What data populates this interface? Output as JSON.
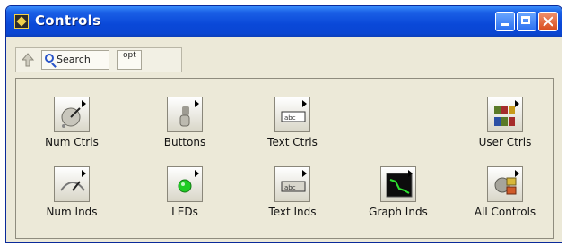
{
  "window": {
    "title": "Controls"
  },
  "toolbar": {
    "search_label": "Search",
    "options_label": "opt"
  },
  "palette": {
    "items": [
      {
        "label": "Num Ctrls",
        "icon": "num-ctrls-icon"
      },
      {
        "label": "Buttons",
        "icon": "buttons-icon"
      },
      {
        "label": "Text Ctrls",
        "icon": "text-ctrls-icon"
      },
      {
        "label": "User Ctrls",
        "icon": "user-ctrls-icon"
      },
      {
        "label": "Num Inds",
        "icon": "num-inds-icon"
      },
      {
        "label": "LEDs",
        "icon": "leds-icon"
      },
      {
        "label": "Text Inds",
        "icon": "text-inds-icon"
      },
      {
        "label": "Graph Inds",
        "icon": "graph-inds-icon"
      },
      {
        "label": "All Controls",
        "icon": "all-controls-icon"
      }
    ]
  }
}
